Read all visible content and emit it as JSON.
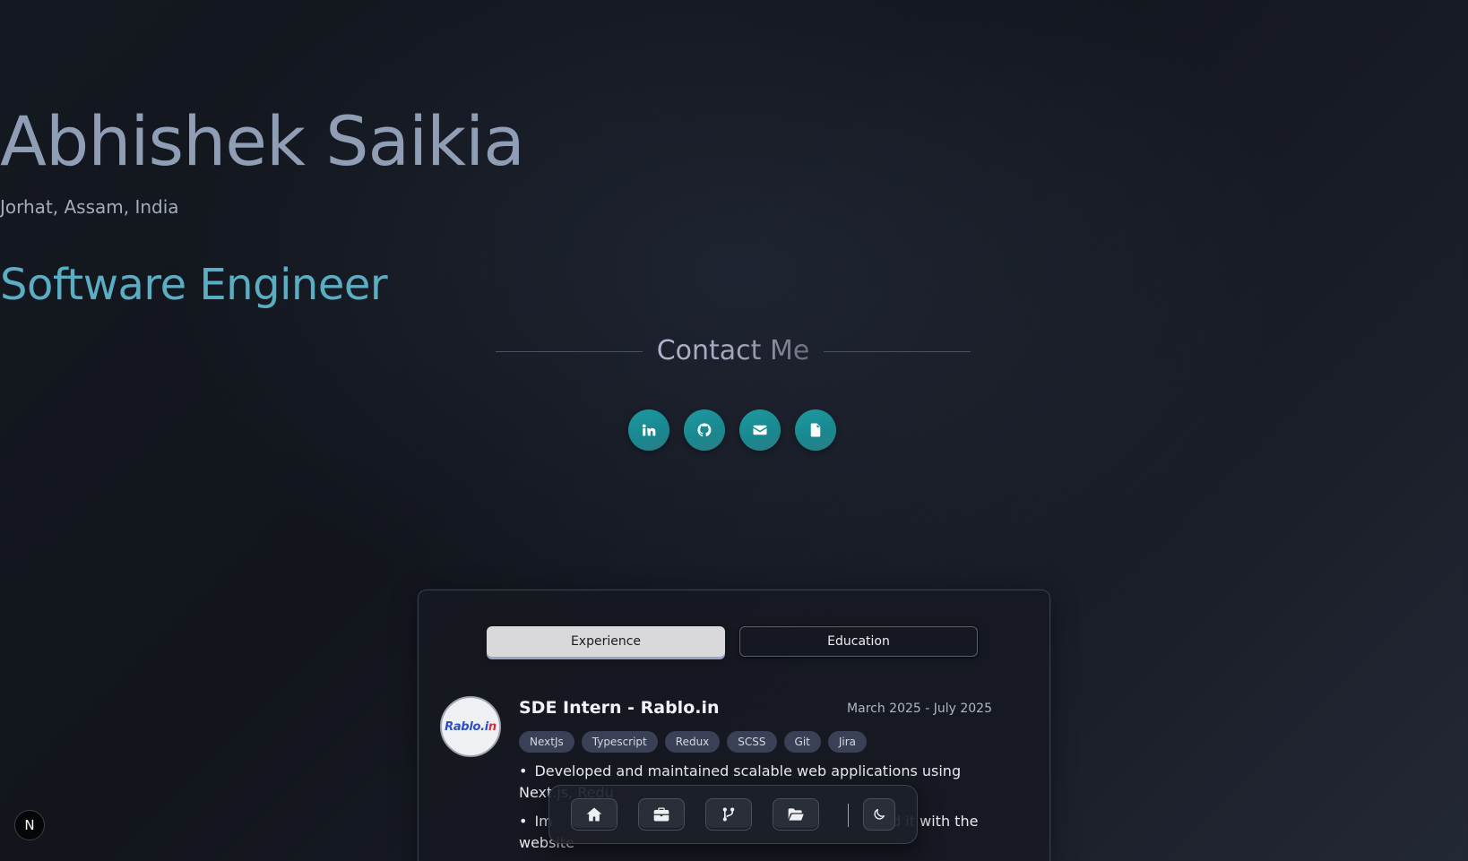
{
  "hero": {
    "name": "Abhishek Saikia",
    "location": "Jorhat, Assam, India",
    "role": "Software Engineer",
    "contact_title": "Contact Me"
  },
  "socials": [
    {
      "icon": "linkedin-icon"
    },
    {
      "icon": "github-icon"
    },
    {
      "icon": "mail-icon"
    },
    {
      "icon": "document-icon"
    }
  ],
  "tabs": {
    "experience": "Experience",
    "education": "Education",
    "active": "Experience"
  },
  "experience": {
    "logo_text": "Rablo.i",
    "logo_text_accent": "n",
    "title": "SDE Intern - Rablo.in",
    "dates": "March 2025 - July 2025",
    "tags": [
      "NextJs",
      "Typescript",
      "Redux",
      "SCSS",
      "Git",
      "Jira"
    ],
    "bullets": [
      "Developed and maintained scalable web applications using Next.js, Redu",
      "Im                                                                    rated it with the website"
    ]
  },
  "dock": {
    "items": [
      "home-icon",
      "briefcase-icon",
      "git-branch-icon",
      "folder-icon"
    ],
    "theme_icon": "moon-icon"
  },
  "badge": {
    "label": "N"
  },
  "colors": {
    "accent_teal": "#1d9aa0",
    "role_color": "#5aaec4",
    "name_color": "#8f9db5"
  }
}
